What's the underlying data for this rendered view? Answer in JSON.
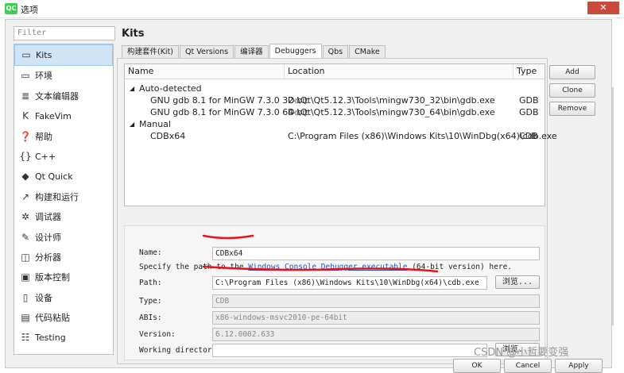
{
  "window": {
    "title": "选项",
    "app_icon": "QC",
    "close_label": "✕"
  },
  "filter": {
    "placeholder": "Filter"
  },
  "sidebar": {
    "items": [
      {
        "label": "Kits",
        "icon": "monitor-icon",
        "glyph": "▭",
        "active": true
      },
      {
        "label": "环境",
        "icon": "monitor-icon",
        "glyph": "▭"
      },
      {
        "label": "文本编辑器",
        "icon": "document-icon",
        "glyph": "≣"
      },
      {
        "label": "FakeVim",
        "icon": "fakevim-icon",
        "glyph": "K"
      },
      {
        "label": "帮助",
        "icon": "help-icon",
        "glyph": "❓"
      },
      {
        "label": "C++",
        "icon": "braces-icon",
        "glyph": "{}"
      },
      {
        "label": "Qt Quick",
        "icon": "qtquick-icon",
        "glyph": "◆"
      },
      {
        "label": "构建和运行",
        "icon": "hammer-icon",
        "glyph": "↗"
      },
      {
        "label": "调试器",
        "icon": "bug-icon",
        "glyph": "✲"
      },
      {
        "label": "设计师",
        "icon": "pencil-icon",
        "glyph": "✎"
      },
      {
        "label": "分析器",
        "icon": "analyzer-icon",
        "glyph": "◫"
      },
      {
        "label": "版本控制",
        "icon": "version-control-icon",
        "glyph": "▣"
      },
      {
        "label": "设备",
        "icon": "device-icon",
        "glyph": "▯"
      },
      {
        "label": "代码粘贴",
        "icon": "paste-icon",
        "glyph": "▤"
      },
      {
        "label": "Testing",
        "icon": "testing-icon",
        "glyph": "☷"
      }
    ]
  },
  "page": {
    "title": "Kits"
  },
  "tabs": [
    "构建套件(Kit)",
    "Qt Versions",
    "编译器",
    "Debuggers",
    "Qbs",
    "CMake"
  ],
  "active_tab": "Debuggers",
  "table": {
    "headers": {
      "name": "Name",
      "location": "Location",
      "type": "Type"
    },
    "auto_group": "Auto-detected",
    "manual_group": "Manual",
    "auto_rows": [
      {
        "name": "GNU gdb 8.1 for MinGW 7.3.0 32-bit",
        "location": "D:\\Qt\\Qt5.12.3\\Tools\\mingw730_32\\bin\\gdb.exe",
        "type": "GDB"
      },
      {
        "name": "GNU gdb 8.1 for MinGW 7.3.0 64-bit",
        "location": "D:\\Qt\\Qt5.12.3\\Tools\\mingw730_64\\bin\\gdb.exe",
        "type": "GDB"
      }
    ],
    "manual_rows": [
      {
        "name": "CDBx64",
        "location": "C:\\Program Files (x86)\\Windows Kits\\10\\WinDbg(x64)\\cdb.exe",
        "type": "CDB"
      }
    ]
  },
  "buttons": {
    "add": "Add",
    "clone": "Clone",
    "remove": "Remove",
    "browse": "浏览...",
    "ok": "OK",
    "cancel": "Cancel",
    "apply": "Apply"
  },
  "details": {
    "name_label": "Name:",
    "name_value": "CDBx64",
    "hint_prefix": "Specify the path to the ",
    "hint_link": "Windows Console Debugger executable",
    "hint_suffix": " (64-bit version) here.",
    "path_label": "Path:",
    "path_value": "C:\\Program Files (x86)\\Windows Kits\\10\\WinDbg(x64)\\cdb.exe",
    "type_label": "Type:",
    "type_value": "CDB",
    "abis_label": "ABIs:",
    "abis_value": "x86-windows-msvc2010-pe-64bit",
    "version_label": "Version:",
    "version_value": "6.12.0002.633",
    "workdir_label": "Working directory:",
    "workdir_value": ""
  },
  "watermark": "CSDN @小哲要变强",
  "annotation_color": "#e8141c"
}
